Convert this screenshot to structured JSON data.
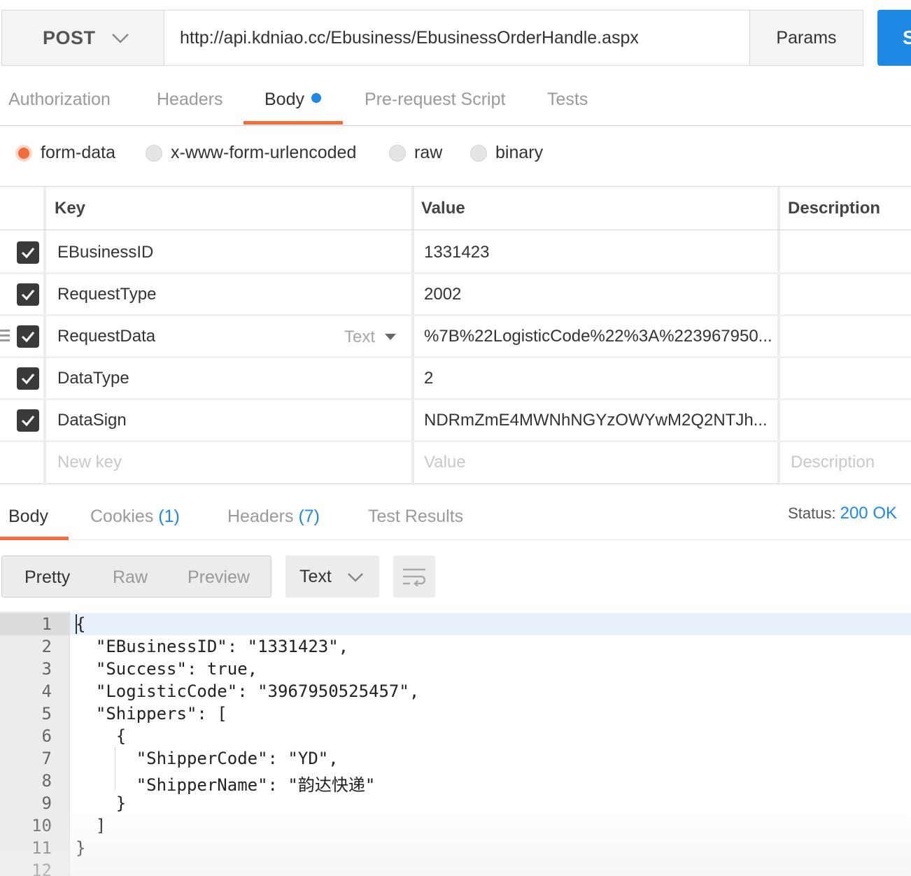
{
  "request": {
    "method": "POST",
    "url": "http://api.kdniao.cc/Ebusiness/EbusinessOrderHandle.aspx",
    "params_label": "Params",
    "send_label": "Send"
  },
  "req_tabs": [
    {
      "label": "Authorization"
    },
    {
      "label": "Headers"
    },
    {
      "label": "Body"
    },
    {
      "label": "Pre-request Script"
    },
    {
      "label": "Tests"
    }
  ],
  "body_types": [
    {
      "label": "form-data",
      "selected": true
    },
    {
      "label": "x-www-form-urlencoded",
      "selected": false
    },
    {
      "label": "raw",
      "selected": false
    },
    {
      "label": "binary",
      "selected": false
    }
  ],
  "table": {
    "headers": {
      "key": "Key",
      "value": "Value",
      "description": "Description"
    },
    "rows": [
      {
        "key": "EBusinessID",
        "value": "1331423",
        "checked": true
      },
      {
        "key": "RequestType",
        "value": "2002",
        "checked": true
      },
      {
        "key": "RequestData",
        "value": "%7B%22LogisticCode%22%3A%223967950...",
        "checked": true,
        "type": "Text"
      },
      {
        "key": "DataType",
        "value": "2",
        "checked": true
      },
      {
        "key": "DataSign",
        "value": "NDRmZmE4MWNhNGYzOWYwM2Q2NTJh...",
        "checked": true
      }
    ],
    "new_row": {
      "key_placeholder": "New key",
      "value_placeholder": "Value",
      "description_placeholder": "Description"
    }
  },
  "res_tabs": [
    {
      "label": "Body",
      "count": ""
    },
    {
      "label": "Cookies",
      "count": "(1)"
    },
    {
      "label": "Headers",
      "count": "(7)"
    },
    {
      "label": "Test Results",
      "count": ""
    }
  ],
  "status": {
    "label": "Status:",
    "value": "200 OK"
  },
  "view": {
    "modes": [
      "Pretty",
      "Raw",
      "Preview"
    ],
    "format": "Text"
  },
  "code_lines": [
    "{",
    "  \"EBusinessID\": \"1331423\",",
    "  \"Success\": true,",
    "  \"LogisticCode\": \"3967950525457\",",
    "  \"Shippers\": [",
    "    {",
    "      \"ShipperCode\": \"YD\",",
    "      \"ShipperName\": \"韵达快递\"",
    "    }",
    "  ]",
    "}",
    ""
  ],
  "line_numbers": [
    "1",
    "2",
    "3",
    "4",
    "5",
    "6",
    "7",
    "8",
    "9",
    "10",
    "11",
    "12"
  ],
  "colors": {
    "accent_orange": "#f26b3a",
    "accent_blue": "#1e88e5"
  },
  "icons": {
    "method_dropdown": "chevron-down-icon",
    "format_dropdown": "chevron-down-icon",
    "wrap": "wrap-lines-icon",
    "check": "check-icon",
    "drag": "drag-handle-icon"
  }
}
